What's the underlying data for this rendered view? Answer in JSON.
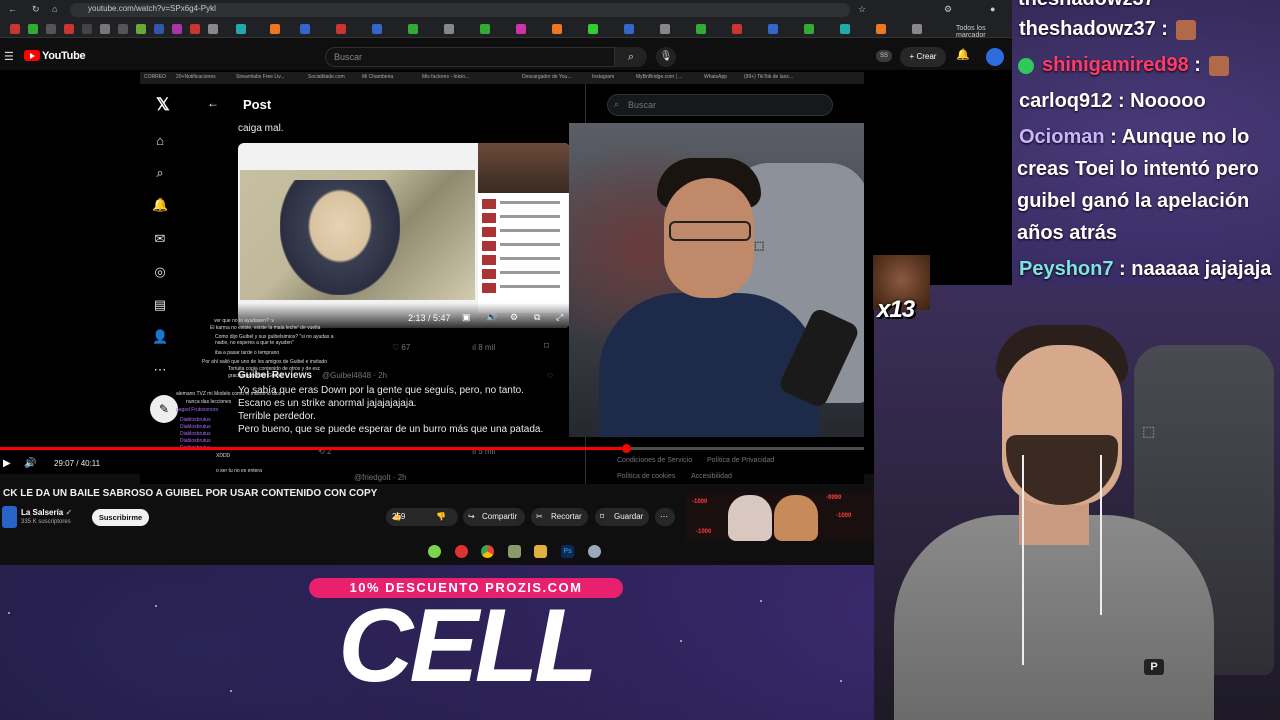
{
  "browser": {
    "url": "youtube.com/watch?v=SPx6g4-Pykl",
    "bookmarks_label": "Todos los marcador"
  },
  "youtube": {
    "logo_text": "YouTube",
    "search_placeholder": "Buscar",
    "create_label": "Crear",
    "ss_label": "SS",
    "player": {
      "current_time": "29:07",
      "total_time": "40:11",
      "time_display": "29:07 / 40:11",
      "progress": 0.724
    },
    "video_title": "CK LE DA UN BAILE SABROSO A GUIBEL POR USAR CONTENIDO CON COPY",
    "channel": {
      "name": "La Salsería",
      "subscribers": "335 K suscriptores",
      "subscribe_label": "Suscribirme"
    },
    "actions": {
      "likes": "259",
      "share": "Compartir",
      "clip": "Recortar",
      "save": "Guardar"
    }
  },
  "embedded_x": {
    "inner_bookmarks": [
      "CORREO",
      "20+Notificaciones",
      "Streamlabs Free Liv...",
      "Socialblade.com",
      "Mi Chamberia",
      "Mis factores - Inicio...",
      "Descargador de You...",
      "Instagram",
      "MyBnBridge.com | ...",
      "WhatsApp",
      "(99+) TikTok de lanz..."
    ],
    "header_title": "Post",
    "search_placeholder": "Buscar",
    "text_top": "caiga mal.",
    "embed_time": "2:13 / 5:47",
    "stats": {
      "likes": "67",
      "views": "8 mil"
    },
    "reply": {
      "author": "Guibel Reviews",
      "handle": "@Guibel4848 · 2h",
      "line1": "Yo sabía que eras Down por la gente que seguís, pero, no tanto.",
      "line2": "Escano es un strike anormal jajajajajaja.",
      "line3": "Terrible perdedor.",
      "line4": "Pero bueno, que se puede esperar de un burro más que una patada."
    },
    "stats2": {
      "comments": "2",
      "views": "5 mil"
    },
    "next_reply": "@friedgolt · 2h",
    "footer": {
      "terms": "Condiciones de Servicio",
      "privacy": "Política de Privacidad",
      "cookies": "Política de cookies",
      "accessibility": "Accesibilidad"
    }
  },
  "stream_chat_overlay": [
    "ver que no lo ayudasen? :v",
    "El karma no existe, existe la mala leche' de vuelta",
    "Como dijo Guibel y sus guibelsimios? \"si no ayudas a",
    "nadie, no esperes a que te ayuden\"",
    "iba a pasar tarde o temprano",
    "Por ahí salió que uno de los amigos de Guibel e invitado",
    "Tortuita copia contenido de otros y de esc",
    "gracias por editar Guibel",
    "alemann TVZ mi Modelo como el mismo lo dice",
    "nunca das lecciones",
    "paged Frutosonoro",
    "Diablosbrutus",
    "Diablosbrutus",
    "Diablosbrutus",
    "Diablosbrutus",
    "Diablosbrutus",
    "XDDD",
    "o ser tu no es entera"
  ],
  "chat": [
    {
      "user": "theshadowz37",
      "user_color": "#ffffff",
      "message": "",
      "partial": true
    },
    {
      "user": "theshadowz37",
      "user_color": "#ffffff",
      "message": ""
    },
    {
      "user": "shinigamired98",
      "user_color": "#ff3b6b",
      "message": ""
    },
    {
      "user": "carloq912",
      "user_color": "#ffffff",
      "message": "Nooooo"
    },
    {
      "user": "Ocioman",
      "user_color": "#c9b6ff",
      "message": "Aunque no lo creas Toei lo intentó pero guibel ganó la apelación años atrás"
    },
    {
      "user": "Peyshon7",
      "user_color": "#7fe3e0",
      "message": "naaaaa jajajaja"
    }
  ],
  "chat_message_lines": {
    "ocioman_line1": "Aunque no lo",
    "ocioman_line2": "creas Toei lo intentó pero",
    "ocioman_line3": "guibel ganó la apelación",
    "ocioman_line4": "años atrás"
  },
  "emote_counter": "x13",
  "promo": {
    "discount": "10% DESCUENTO PROZIS.COM",
    "code": "CELL"
  },
  "colors": {
    "youtube_red": "#ff0000",
    "promo_pink": "#e8206e",
    "shinigami": "#ff3b6b",
    "ocioman": "#c9b6ff",
    "peyshon": "#7fe3e0"
  }
}
